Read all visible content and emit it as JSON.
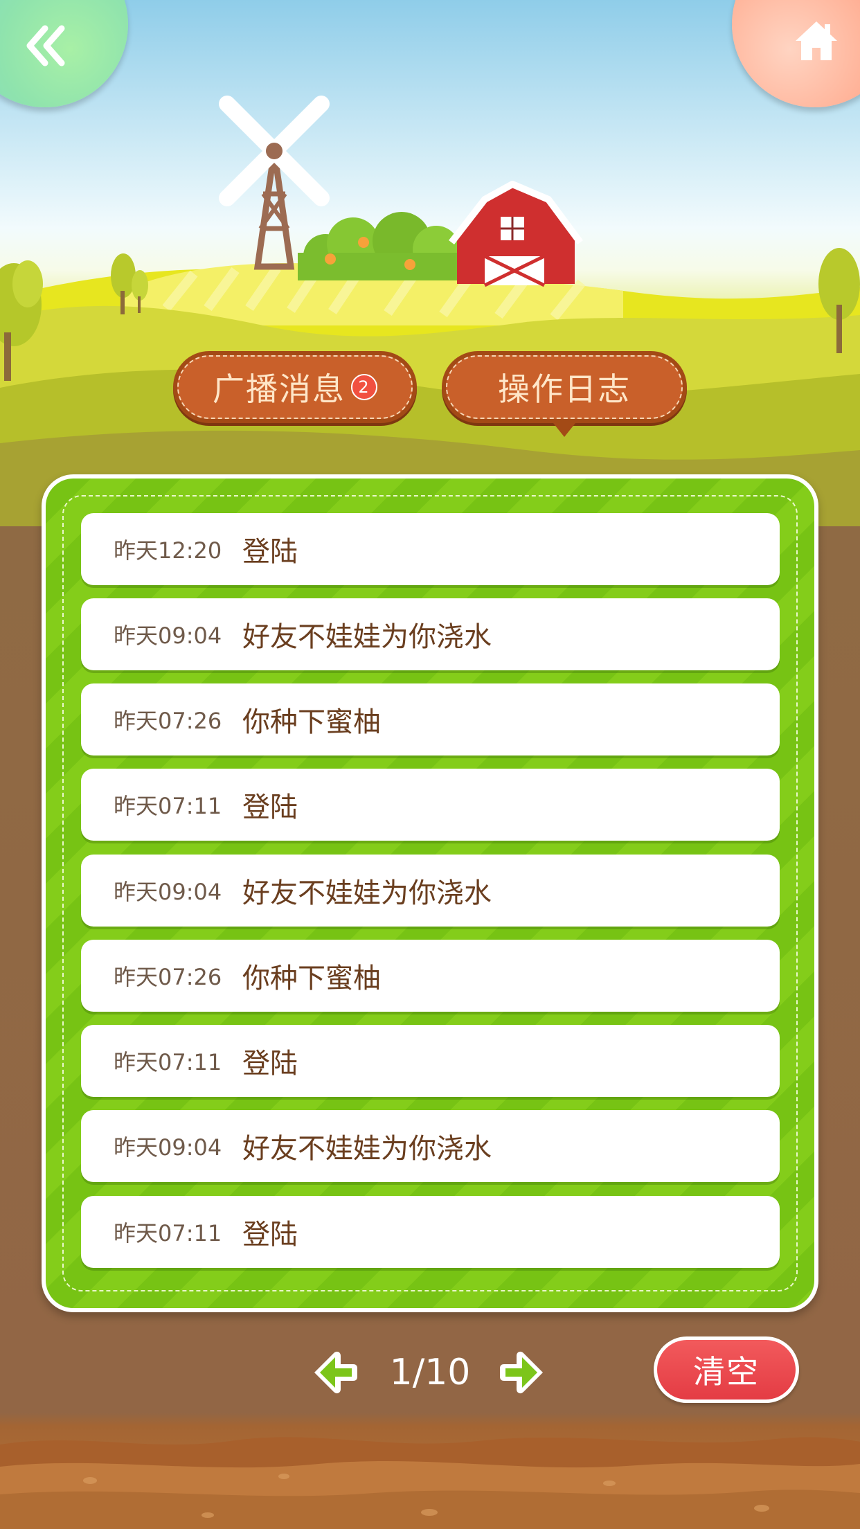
{
  "header": {
    "back_icon": "double-chevron-left-icon",
    "home_icon": "home-icon"
  },
  "tabs": [
    {
      "label": "广播消息",
      "badge": "2",
      "active": false
    },
    {
      "label": "操作日志",
      "active": true
    }
  ],
  "log": {
    "items": [
      {
        "time": "昨天12:20",
        "text": "登陆"
      },
      {
        "time": "昨天09:04",
        "text": "好友不娃娃为你浇水"
      },
      {
        "time": "昨天07:26",
        "text": "你种下蜜柚"
      },
      {
        "time": "昨天07:11",
        "text": "登陆"
      },
      {
        "time": "昨天09:04",
        "text": "好友不娃娃为你浇水"
      },
      {
        "time": "昨天07:26",
        "text": "你种下蜜柚"
      },
      {
        "time": "昨天07:11",
        "text": "登陆"
      },
      {
        "time": "昨天09:04",
        "text": "好友不娃娃为你浇水"
      },
      {
        "time": "昨天07:11",
        "text": "登陆"
      }
    ]
  },
  "pagination": {
    "text": "1/10",
    "prev_icon": "arrow-left-icon",
    "next_icon": "arrow-right-icon"
  },
  "actions": {
    "clear_label": "清空"
  },
  "colors": {
    "panel_green": "#77c314",
    "tab_brown": "#c9602a",
    "clear_red": "#e43c44",
    "soil": "#926645"
  }
}
